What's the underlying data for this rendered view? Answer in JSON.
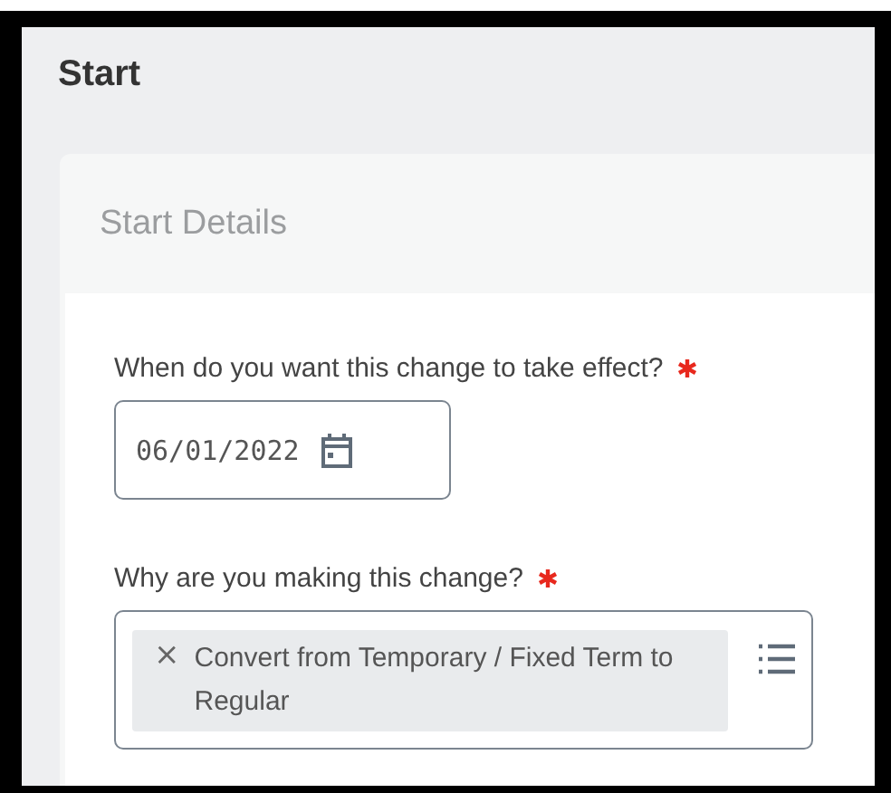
{
  "page": {
    "title": "Start"
  },
  "section": {
    "title": "Start Details"
  },
  "fields": [
    {
      "kind": "date",
      "label": "When do you want this change to take effect?",
      "required": true,
      "value": "06/01/2022"
    },
    {
      "kind": "multiselect",
      "label": "Why are you making this change?",
      "required": true,
      "chips": [
        {
          "remove": "×",
          "text": "Convert from Temporary / Fixed Term to Regular"
        }
      ]
    }
  ]
}
